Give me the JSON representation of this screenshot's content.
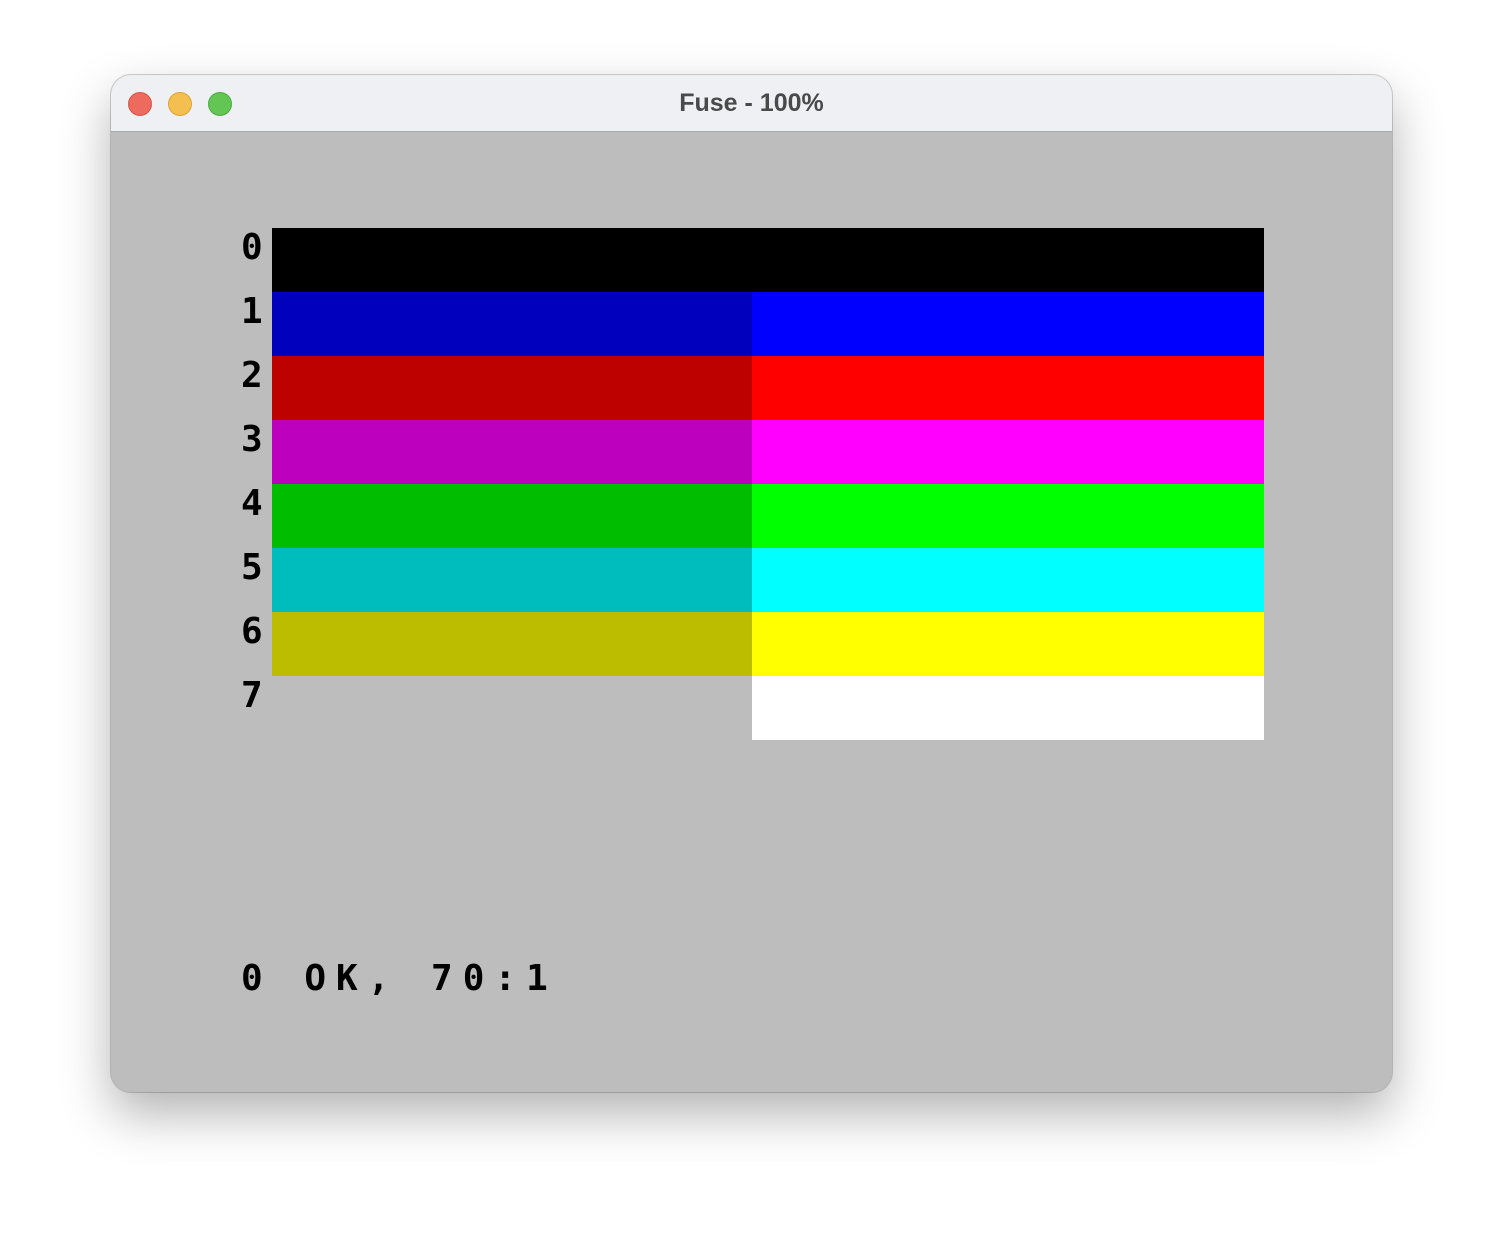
{
  "window": {
    "title": "Fuse - 100%"
  },
  "screen": {
    "border_color": "#bdbdbd",
    "rows": [
      {
        "label": "0",
        "normal": "#000000",
        "bright": "#000000"
      },
      {
        "label": "1",
        "normal": "#0000bd",
        "bright": "#0000ff"
      },
      {
        "label": "2",
        "normal": "#bd0000",
        "bright": "#ff0000"
      },
      {
        "label": "3",
        "normal": "#bd00bd",
        "bright": "#ff00ff"
      },
      {
        "label": "4",
        "normal": "#00bd00",
        "bright": "#00ff00"
      },
      {
        "label": "5",
        "normal": "#00bdbd",
        "bright": "#00ffff"
      },
      {
        "label": "6",
        "normal": "#bdbd00",
        "bright": "#ffff00"
      },
      {
        "label": "7",
        "normal": "#bdbdbd",
        "bright": "#ffffff"
      }
    ],
    "status": "0 OK, 70:1"
  }
}
